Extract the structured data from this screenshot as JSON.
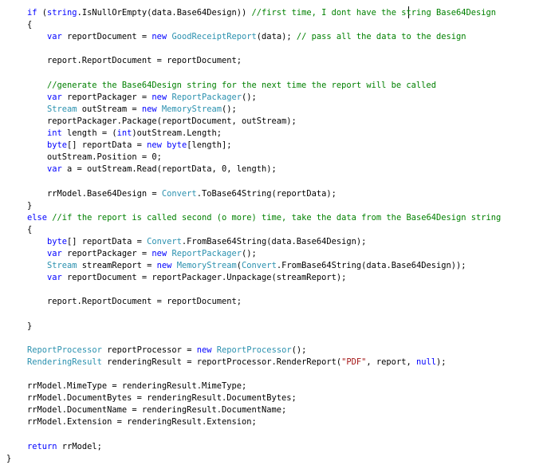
{
  "editor": {
    "lines": [
      {
        "indent": 34,
        "tokens": [
          {
            "t": "if",
            "c": "kw"
          },
          {
            "t": " (",
            "c": "plain"
          },
          {
            "t": "string",
            "c": "kw"
          },
          {
            "t": ".IsNullOrEmpty(data.Base64Design)) ",
            "c": "plain"
          },
          {
            "t": "//first time, I dont have the string Base64Design",
            "c": "cm"
          }
        ]
      },
      {
        "indent": 34,
        "tokens": [
          {
            "t": "{",
            "c": "plain"
          }
        ]
      },
      {
        "indent": 59,
        "tokens": [
          {
            "t": "var",
            "c": "kw"
          },
          {
            "t": " reportDocument = ",
            "c": "plain"
          },
          {
            "t": "new",
            "c": "kw"
          },
          {
            "t": " ",
            "c": "plain"
          },
          {
            "t": "GoodReceiptReport",
            "c": "type"
          },
          {
            "t": "(data); ",
            "c": "plain"
          },
          {
            "t": "// pass all the data to the design",
            "c": "cm"
          }
        ]
      },
      {
        "indent": 59,
        "tokens": []
      },
      {
        "indent": 59,
        "tokens": [
          {
            "t": "report.ReportDocument = reportDocument;",
            "c": "plain"
          }
        ]
      },
      {
        "indent": 59,
        "tokens": []
      },
      {
        "indent": 59,
        "tokens": [
          {
            "t": "//generate the Base64Design string for the next time the report will be called",
            "c": "cm"
          }
        ]
      },
      {
        "indent": 59,
        "tokens": [
          {
            "t": "var",
            "c": "kw"
          },
          {
            "t": " reportPackager = ",
            "c": "plain"
          },
          {
            "t": "new",
            "c": "kw"
          },
          {
            "t": " ",
            "c": "plain"
          },
          {
            "t": "ReportPackager",
            "c": "type"
          },
          {
            "t": "();",
            "c": "plain"
          }
        ]
      },
      {
        "indent": 59,
        "tokens": [
          {
            "t": "Stream",
            "c": "type"
          },
          {
            "t": " outStream = ",
            "c": "plain"
          },
          {
            "t": "new",
            "c": "kw"
          },
          {
            "t": " ",
            "c": "plain"
          },
          {
            "t": "MemoryStream",
            "c": "type"
          },
          {
            "t": "();",
            "c": "plain"
          }
        ]
      },
      {
        "indent": 59,
        "tokens": [
          {
            "t": "reportPackager.Package(reportDocument, outStream);",
            "c": "plain"
          }
        ]
      },
      {
        "indent": 59,
        "tokens": [
          {
            "t": "int",
            "c": "kw"
          },
          {
            "t": " length = (",
            "c": "plain"
          },
          {
            "t": "int",
            "c": "kw"
          },
          {
            "t": ")outStream.Length;",
            "c": "plain"
          }
        ]
      },
      {
        "indent": 59,
        "tokens": [
          {
            "t": "byte",
            "c": "kw"
          },
          {
            "t": "[] reportData = ",
            "c": "plain"
          },
          {
            "t": "new",
            "c": "kw"
          },
          {
            "t": " ",
            "c": "plain"
          },
          {
            "t": "byte",
            "c": "kw"
          },
          {
            "t": "[length];",
            "c": "plain"
          }
        ]
      },
      {
        "indent": 59,
        "tokens": [
          {
            "t": "outStream.Position = 0;",
            "c": "plain"
          }
        ]
      },
      {
        "indent": 59,
        "tokens": [
          {
            "t": "var",
            "c": "kw"
          },
          {
            "t": " a = outStream.Read(reportData, 0, length);",
            "c": "plain"
          }
        ]
      },
      {
        "indent": 59,
        "tokens": []
      },
      {
        "indent": 59,
        "tokens": [
          {
            "t": "rrModel.Base64Design = ",
            "c": "plain"
          },
          {
            "t": "Convert",
            "c": "type"
          },
          {
            "t": ".ToBase64String(reportData);",
            "c": "plain"
          }
        ]
      },
      {
        "indent": 34,
        "tokens": [
          {
            "t": "}",
            "c": "plain"
          }
        ]
      },
      {
        "indent": 34,
        "tokens": [
          {
            "t": "else",
            "c": "kw"
          },
          {
            "t": " ",
            "c": "plain"
          },
          {
            "t": "//if the report is called second (o more) time, take the data from the Base64Design string",
            "c": "cm"
          }
        ]
      },
      {
        "indent": 34,
        "tokens": [
          {
            "t": "{",
            "c": "plain"
          }
        ]
      },
      {
        "indent": 59,
        "tokens": [
          {
            "t": "byte",
            "c": "kw"
          },
          {
            "t": "[] reportData = ",
            "c": "plain"
          },
          {
            "t": "Convert",
            "c": "type"
          },
          {
            "t": ".FromBase64String(data.Base64Design);",
            "c": "plain"
          }
        ]
      },
      {
        "indent": 59,
        "tokens": [
          {
            "t": "var",
            "c": "kw"
          },
          {
            "t": " reportPackager = ",
            "c": "plain"
          },
          {
            "t": "new",
            "c": "kw"
          },
          {
            "t": " ",
            "c": "plain"
          },
          {
            "t": "ReportPackager",
            "c": "type"
          },
          {
            "t": "();",
            "c": "plain"
          }
        ]
      },
      {
        "indent": 59,
        "tokens": [
          {
            "t": "Stream",
            "c": "type"
          },
          {
            "t": " streamReport = ",
            "c": "plain"
          },
          {
            "t": "new",
            "c": "kw"
          },
          {
            "t": " ",
            "c": "plain"
          },
          {
            "t": "MemoryStream",
            "c": "type"
          },
          {
            "t": "(",
            "c": "plain"
          },
          {
            "t": "Convert",
            "c": "type"
          },
          {
            "t": ".FromBase64String(data.Base64Design));",
            "c": "plain"
          }
        ]
      },
      {
        "indent": 59,
        "tokens": [
          {
            "t": "var",
            "c": "kw"
          },
          {
            "t": " reportDocument = reportPackager.Unpackage(streamReport);",
            "c": "plain"
          }
        ]
      },
      {
        "indent": 59,
        "tokens": []
      },
      {
        "indent": 59,
        "tokens": [
          {
            "t": "report.ReportDocument = reportDocument;",
            "c": "plain"
          }
        ]
      },
      {
        "indent": 59,
        "tokens": []
      },
      {
        "indent": 34,
        "tokens": [
          {
            "t": "}",
            "c": "plain"
          }
        ]
      },
      {
        "indent": 34,
        "tokens": []
      },
      {
        "indent": 34,
        "tokens": [
          {
            "t": "ReportProcessor",
            "c": "type"
          },
          {
            "t": " reportProcessor = ",
            "c": "plain"
          },
          {
            "t": "new",
            "c": "kw"
          },
          {
            "t": " ",
            "c": "plain"
          },
          {
            "t": "ReportProcessor",
            "c": "type"
          },
          {
            "t": "();",
            "c": "plain"
          }
        ]
      },
      {
        "indent": 34,
        "tokens": [
          {
            "t": "RenderingResult",
            "c": "type"
          },
          {
            "t": " renderingResult = reportProcessor.RenderReport(",
            "c": "plain"
          },
          {
            "t": "\"PDF\"",
            "c": "str"
          },
          {
            "t": ", report, ",
            "c": "plain"
          },
          {
            "t": "null",
            "c": "kw"
          },
          {
            "t": ");",
            "c": "plain"
          }
        ]
      },
      {
        "indent": 34,
        "tokens": []
      },
      {
        "indent": 34,
        "tokens": [
          {
            "t": "rrModel.MimeType = renderingResult.MimeType;",
            "c": "plain"
          }
        ]
      },
      {
        "indent": 34,
        "tokens": [
          {
            "t": "rrModel.DocumentBytes = renderingResult.DocumentBytes;",
            "c": "plain"
          }
        ]
      },
      {
        "indent": 34,
        "tokens": [
          {
            "t": "rrModel.DocumentName = renderingResult.DocumentName;",
            "c": "plain"
          }
        ]
      },
      {
        "indent": 34,
        "tokens": [
          {
            "t": "rrModel.Extension = renderingResult.Extension;",
            "c": "plain"
          }
        ]
      },
      {
        "indent": 34,
        "tokens": []
      },
      {
        "indent": 34,
        "tokens": [
          {
            "t": "return",
            "c": "kw"
          },
          {
            "t": " rrModel;",
            "c": "plain"
          }
        ]
      },
      {
        "indent": 8,
        "tokens": [
          {
            "t": "}",
            "c": "plain"
          }
        ]
      }
    ],
    "colors": {
      "keyword": "#0000ff",
      "type": "#2b91af",
      "comment": "#008000",
      "string": "#a31515",
      "plain": "#000000",
      "background": "#ffffff"
    }
  }
}
